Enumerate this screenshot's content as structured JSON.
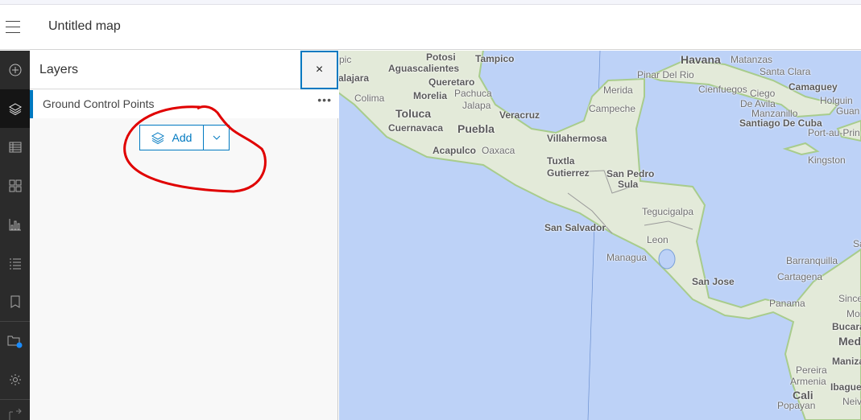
{
  "header": {
    "title": "Untitled map",
    "menu_icon": "hamburger-icon"
  },
  "rail": {
    "items": [
      {
        "name": "add",
        "icon": "plus-circle-icon"
      },
      {
        "name": "layers",
        "icon": "layers-icon",
        "active": true
      },
      {
        "name": "tables",
        "icon": "table-icon"
      },
      {
        "name": "legend",
        "icon": "legend-icon"
      },
      {
        "name": "charts",
        "icon": "chart-icon"
      },
      {
        "name": "properties",
        "icon": "list-icon"
      },
      {
        "name": "bookmarks",
        "icon": "bookmark-icon"
      },
      {
        "name": "save",
        "icon": "folder-icon",
        "badge": true
      },
      {
        "name": "settings",
        "icon": "gear-icon"
      },
      {
        "name": "share",
        "icon": "share-icon"
      }
    ]
  },
  "panel": {
    "title": "Layers",
    "close_label": "×",
    "layers": [
      {
        "name": "Ground Control Points"
      }
    ],
    "more_label": "•••",
    "add_label": "Add"
  },
  "colors": {
    "accent": "#0079c1",
    "ocean": "#bdd2f7",
    "land": "#e3ead9",
    "annotation": "#e00000"
  },
  "map": {
    "labels": [
      "pic",
      "Potosi",
      "Tampico",
      "Aguascalientes",
      "alajara",
      "Queretaro",
      "Pachuca",
      "Colima",
      "Morelia",
      "Jalapa",
      "Toluca",
      "Veracruz",
      "Cuernavaca",
      "Puebla",
      "Acapulco",
      "Oaxaca",
      "Merida",
      "Campeche",
      "Villahermosa",
      "Tuxtla",
      "Gutierrez",
      "San Pedro",
      "Sula",
      "Tegucigalpa",
      "San Salvador",
      "Leon",
      "Managua",
      "San Jose",
      "Havana",
      "Matanzas",
      "Pinar Del Rio",
      "Santa Clara",
      "Cienfuegos",
      "Ciego",
      "De Avila",
      "Camaguey",
      "Manzanillo",
      "Holguin",
      "Guan",
      "Santiago De Cuba",
      "Port-au-Prin",
      "Kingston",
      "Barranquilla",
      "Cartagena",
      "Panama",
      "Since",
      "Monteria",
      "Bucaraman",
      "Medel",
      "Manizale",
      "Pereira",
      "Armenia",
      "Ibague",
      "Cali",
      "Popayan",
      "Neiv",
      "Sa"
    ]
  }
}
